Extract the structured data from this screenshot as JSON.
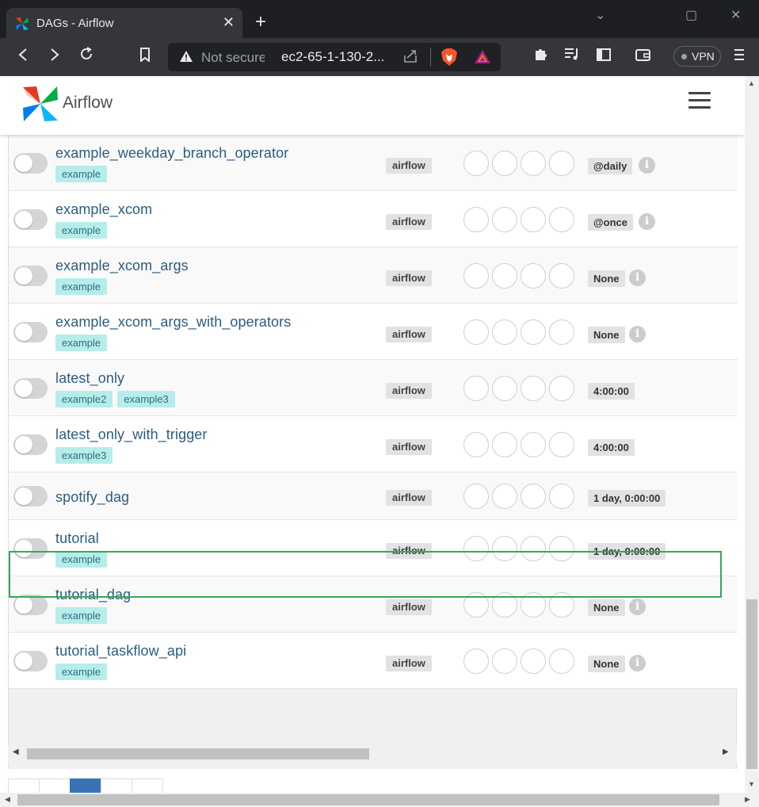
{
  "browser": {
    "tab_title": "DAGs - Airflow",
    "tab_close": "✕",
    "new_tab": "+",
    "not_secure": "Not secure",
    "url": "ec2-65-1-130-2...",
    "vpn_label": "VPN",
    "minimize": "⌄",
    "maximize": "▢",
    "close": "✕"
  },
  "app": {
    "logo_text": "Airflow"
  },
  "dags": [
    {
      "name": "example_weekday_branch_operator",
      "tags": [
        "example"
      ],
      "owner": "airflow",
      "schedule": "@daily",
      "info": "i"
    },
    {
      "name": "example_xcom",
      "tags": [
        "example"
      ],
      "owner": "airflow",
      "schedule": "@once",
      "info": "i"
    },
    {
      "name": "example_xcom_args",
      "tags": [
        "example"
      ],
      "owner": "airflow",
      "schedule": "None",
      "info": "i"
    },
    {
      "name": "example_xcom_args_with_operators",
      "tags": [
        "example"
      ],
      "owner": "airflow",
      "schedule": "None",
      "info": "i"
    },
    {
      "name": "latest_only",
      "tags": [
        "example2",
        "example3"
      ],
      "owner": "airflow",
      "schedule": "4:00:00"
    },
    {
      "name": "latest_only_with_trigger",
      "tags": [
        "example3"
      ],
      "owner": "airflow",
      "schedule": "4:00:00"
    },
    {
      "name": "spotify_dag",
      "tags": [],
      "owner": "airflow",
      "schedule": "1 day, 0:00:00",
      "highlighted": true
    },
    {
      "name": "tutorial",
      "tags": [
        "example"
      ],
      "owner": "airflow",
      "schedule": "1 day, 0:00:00"
    },
    {
      "name": "tutorial_dag",
      "tags": [
        "example"
      ],
      "owner": "airflow",
      "schedule": "None",
      "info": "i"
    },
    {
      "name": "tutorial_taskflow_api",
      "tags": [
        "example"
      ],
      "owner": "airflow",
      "schedule": "None",
      "info": "i"
    }
  ],
  "colors": {
    "dag_name": "#2b5d7f",
    "tag_bg": "#b7ede8",
    "highlight_border": "#3aa65a",
    "active_page": "#3a73b5"
  }
}
